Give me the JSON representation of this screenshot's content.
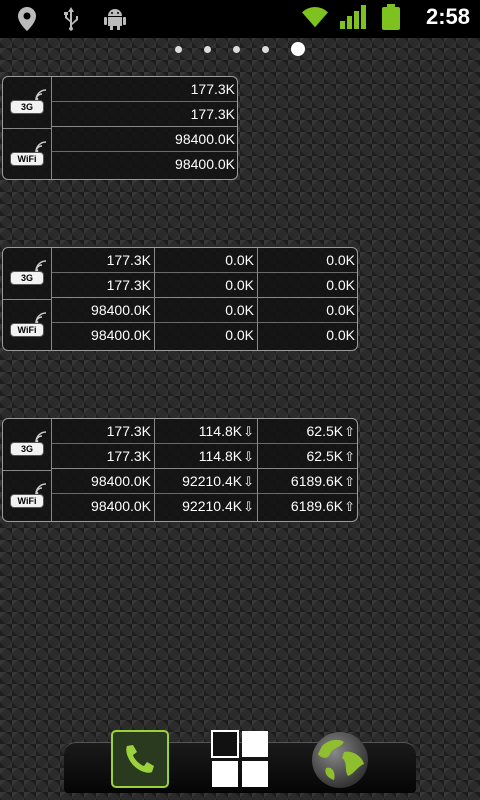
{
  "status_bar": {
    "time": "2:58",
    "left_icons": [
      "location-icon",
      "usb-icon",
      "android-debug-icon"
    ],
    "right_icons": [
      "wifi-icon",
      "signal-icon",
      "battery-icon"
    ]
  },
  "page_indicator": {
    "count": 5,
    "active_index": 4
  },
  "network_labels": {
    "mobile": "3G",
    "wifi": "WiFi"
  },
  "widgets": [
    {
      "columns": [
        {
          "cells": [
            "177.3K",
            "177.3K",
            "98400.0K",
            "98400.0K"
          ]
        }
      ]
    },
    {
      "columns": [
        {
          "cells": [
            "177.3K",
            "177.3K",
            "98400.0K",
            "98400.0K"
          ]
        },
        {
          "cells": [
            "0.0K",
            "0.0K",
            "0.0K",
            "0.0K"
          ]
        },
        {
          "cells": [
            "0.0K",
            "0.0K",
            "0.0K",
            "0.0K"
          ]
        }
      ]
    },
    {
      "columns": [
        {
          "cells": [
            "177.3K",
            "177.3K",
            "98400.0K",
            "98400.0K"
          ]
        },
        {
          "cells": [
            "114.8K",
            "114.8K",
            "92210.4K",
            "92210.4K"
          ],
          "arrow": "⇩"
        },
        {
          "cells": [
            "62.5K",
            "62.5K",
            "6189.6K",
            "6189.6K"
          ],
          "arrow": "⇧"
        }
      ]
    }
  ],
  "dock": {
    "items": [
      "phone-icon",
      "apps-grid-icon",
      "browser-globe-icon"
    ]
  },
  "colors": {
    "accent_green": "#9bd13b",
    "status_green": "#7dc21e"
  }
}
